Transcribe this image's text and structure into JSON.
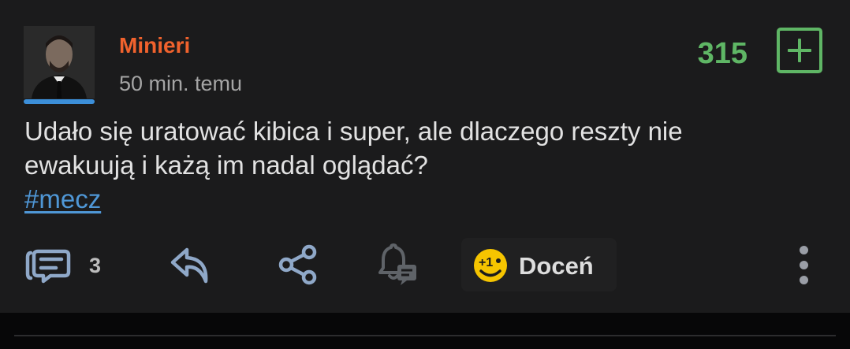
{
  "entry": {
    "author": "Minieri",
    "time": "50 min. temu",
    "votes": "315",
    "body_line1": "Udało się uratować kibica i super, ale dlaczego reszty nie",
    "body_line2": "ewakuują i każą im nadal oglądać?",
    "hashtag": "#mecz"
  },
  "actions": {
    "comments_count": "3",
    "docen_label": "Doceń",
    "docen_badge": "+1"
  },
  "colors": {
    "author": "#f0622d",
    "votes": "#5fb665",
    "link": "#4f97d6",
    "accent": "#3c8fd9",
    "docen_badge": "#f5c400"
  },
  "icons": [
    "comments-icon",
    "reply-icon",
    "share-icon",
    "notification-bell-icon",
    "docen-plus-one-icon",
    "more-options-icon",
    "upvote-plus-icon"
  ]
}
